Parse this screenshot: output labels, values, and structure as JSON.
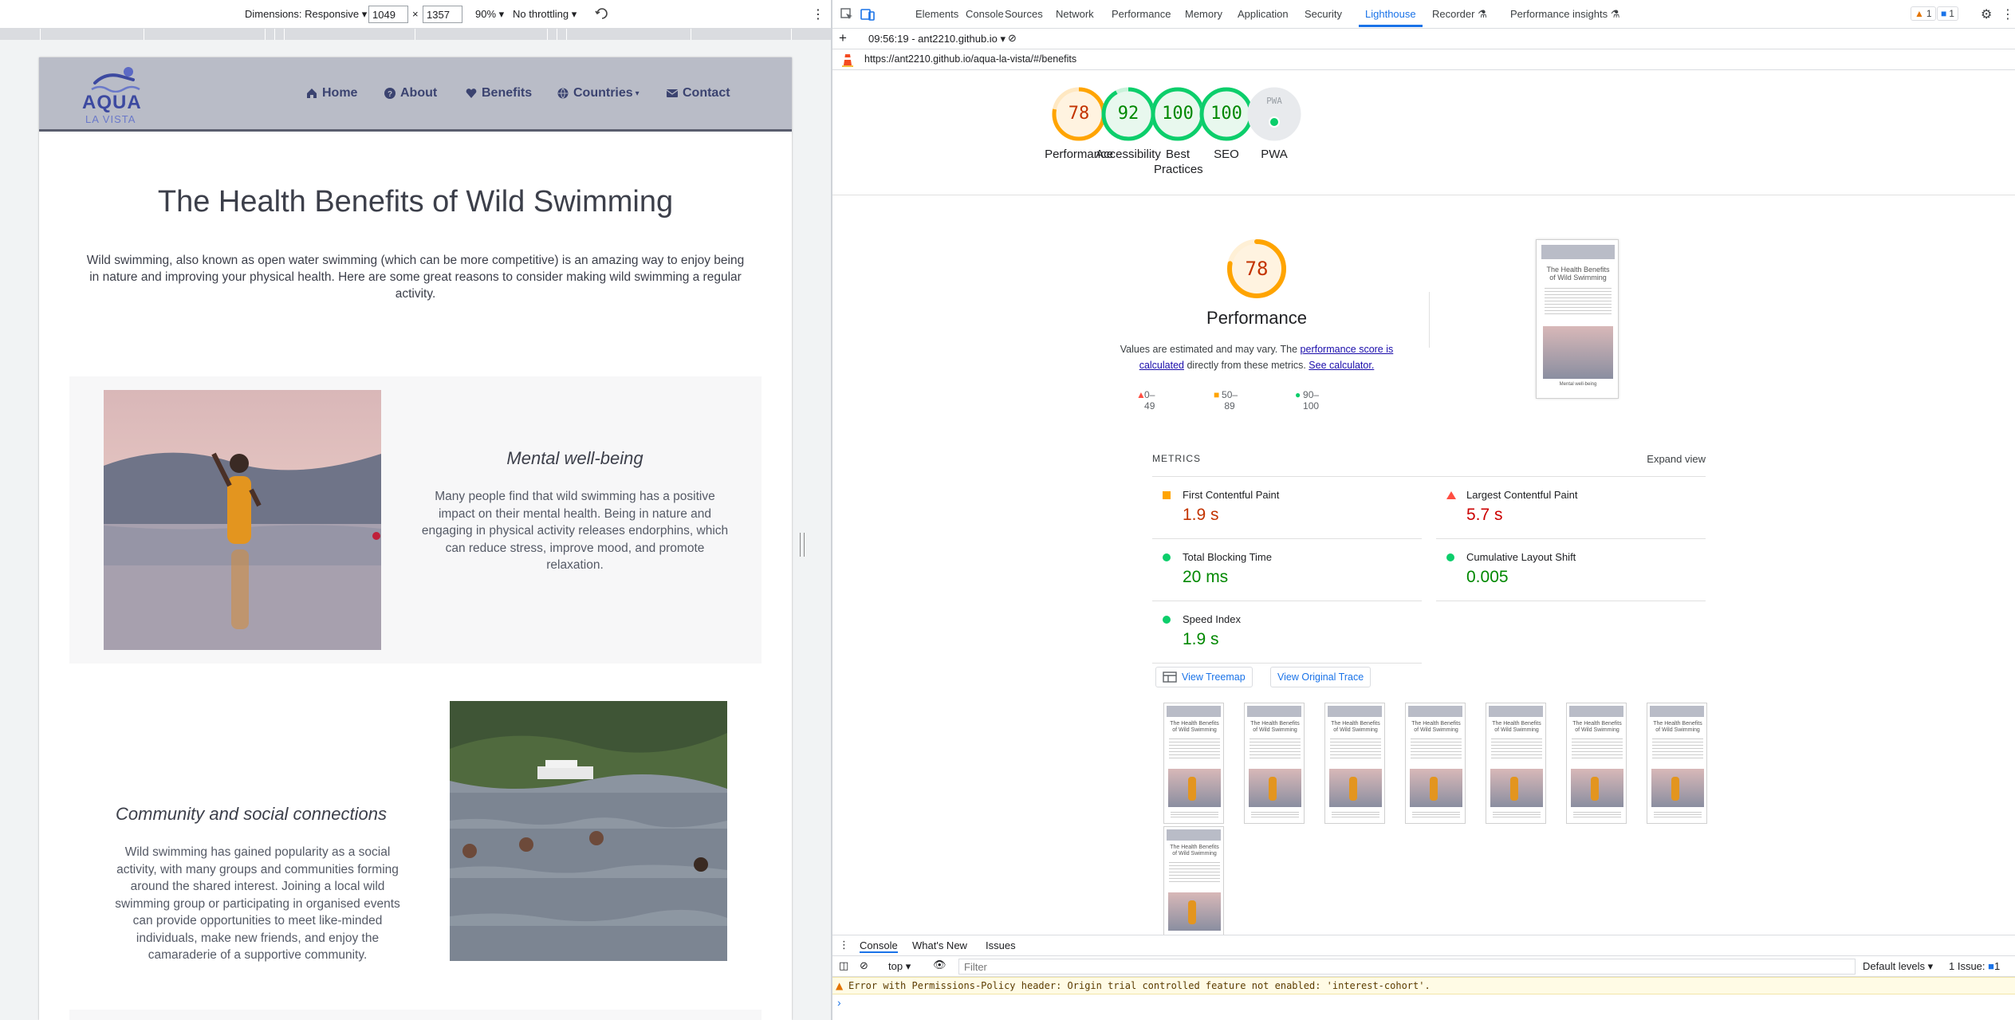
{
  "device_toolbar": {
    "dimensions_label": "Dimensions: Responsive",
    "width": "1049",
    "x": "×",
    "height": "1357",
    "zoom": "90%",
    "throttle": "No throttling"
  },
  "site": {
    "logo": {
      "word": "AQUA",
      "sub": "LA VISTA"
    },
    "nav": {
      "home": "Home",
      "about": "About",
      "benefits": "Benefits",
      "countries": "Countries",
      "contact": "Contact"
    },
    "title": "The Health Benefits of Wild Swimming",
    "intro": "Wild swimming, also known as open water swimming (which can be more competitive) is an amazing way to enjoy being in nature and improving your physical health. Here are some great reasons to consider making wild swimming a regular activity.",
    "card1": {
      "heading": "Mental well-being",
      "text": "Many people find that wild swimming has a positive impact on their mental health. Being in nature and engaging in physical activity releases endorphins, which can reduce stress, improve mood, and promote relaxation."
    },
    "card2": {
      "heading": "Community and social connections",
      "text": "Wild swimming has gained popularity as a social activity, with many groups and communities forming around the shared interest. Joining a local wild swimming group or participating in organised events can provide opportunities to meet like-minded individuals, make new friends, and enjoy the camaraderie of a supportive community."
    }
  },
  "devtools": {
    "tabs": {
      "elements": "Elements",
      "console": "Console",
      "sources": "Sources",
      "network": "Network",
      "performance": "Performance",
      "memory": "Memory",
      "application": "Application",
      "security": "Security",
      "lighthouse": "Lighthouse",
      "recorder": "Recorder",
      "perf_insights": "Performance insights"
    },
    "badges": {
      "warnings": "1",
      "messages": "1"
    },
    "report_select": "09:56:19 - ant2210.github.io",
    "url": "https://ant2210.github.io/aqua-la-vista/#/benefits",
    "gauges": [
      {
        "label": "Performance",
        "value": "78",
        "score": 0.78,
        "color": "#ffa400",
        "text_color": "#c33300"
      },
      {
        "label": "Accessibility",
        "value": "92",
        "score": 0.92,
        "color": "#0cce6b",
        "text_color": "#008800"
      },
      {
        "label": "Best Practices",
        "value": "100",
        "score": 1.0,
        "color": "#0cce6b",
        "text_color": "#008800"
      },
      {
        "label": "SEO",
        "value": "100",
        "score": 1.0,
        "color": "#0cce6b",
        "text_color": "#008800"
      },
      {
        "label": "PWA",
        "value": "PWA",
        "score": 0,
        "color": "#9aa0a6",
        "text_color": "#9aa0a6"
      }
    ],
    "perf": {
      "score": "78",
      "title": "Performance",
      "desc_pre": "Values are estimated and may vary. The ",
      "link1": "performance score is calculated",
      "desc_mid": " directly from these metrics. ",
      "link2": "See calculator.",
      "legend": {
        "fail": "0–49",
        "average": "50–89",
        "pass": "90–100"
      }
    },
    "metrics": {
      "header": "METRICS",
      "expand": "Expand view",
      "items": [
        {
          "name": "First Contentful Paint",
          "value": "1.9 s",
          "status": "average"
        },
        {
          "name": "Largest Contentful Paint",
          "value": "5.7 s",
          "status": "fail"
        },
        {
          "name": "Total Blocking Time",
          "value": "20 ms",
          "status": "pass"
        },
        {
          "name": "Cumulative Layout Shift",
          "value": "0.005",
          "status": "pass"
        },
        {
          "name": "Speed Index",
          "value": "1.9 s",
          "status": "pass"
        }
      ]
    },
    "buttons": {
      "treemap": "View Treemap",
      "trace": "View Original Trace"
    },
    "thumb_title": "The Health Benefits of Wild Swimming",
    "thumb_caption": "Mental well-being",
    "console": {
      "tab_console": "Console",
      "tab_whats_new": "What's New",
      "tab_issues": "Issues",
      "context": "top",
      "filter_placeholder": "Filter",
      "levels": "Default levels",
      "issues": "1 Issue:",
      "issues_count": "1",
      "warning": "Error with Permissions-Policy header: Origin trial controlled feature not enabled: 'interest-cohort'.",
      "prompt": "›"
    }
  },
  "colors": {
    "pass": "#0cce6b",
    "average": "#ffa400",
    "fail": "#ff4e42",
    "pass_text": "#008800",
    "average_text": "#c33300",
    "fail_text": "#cc0000"
  }
}
